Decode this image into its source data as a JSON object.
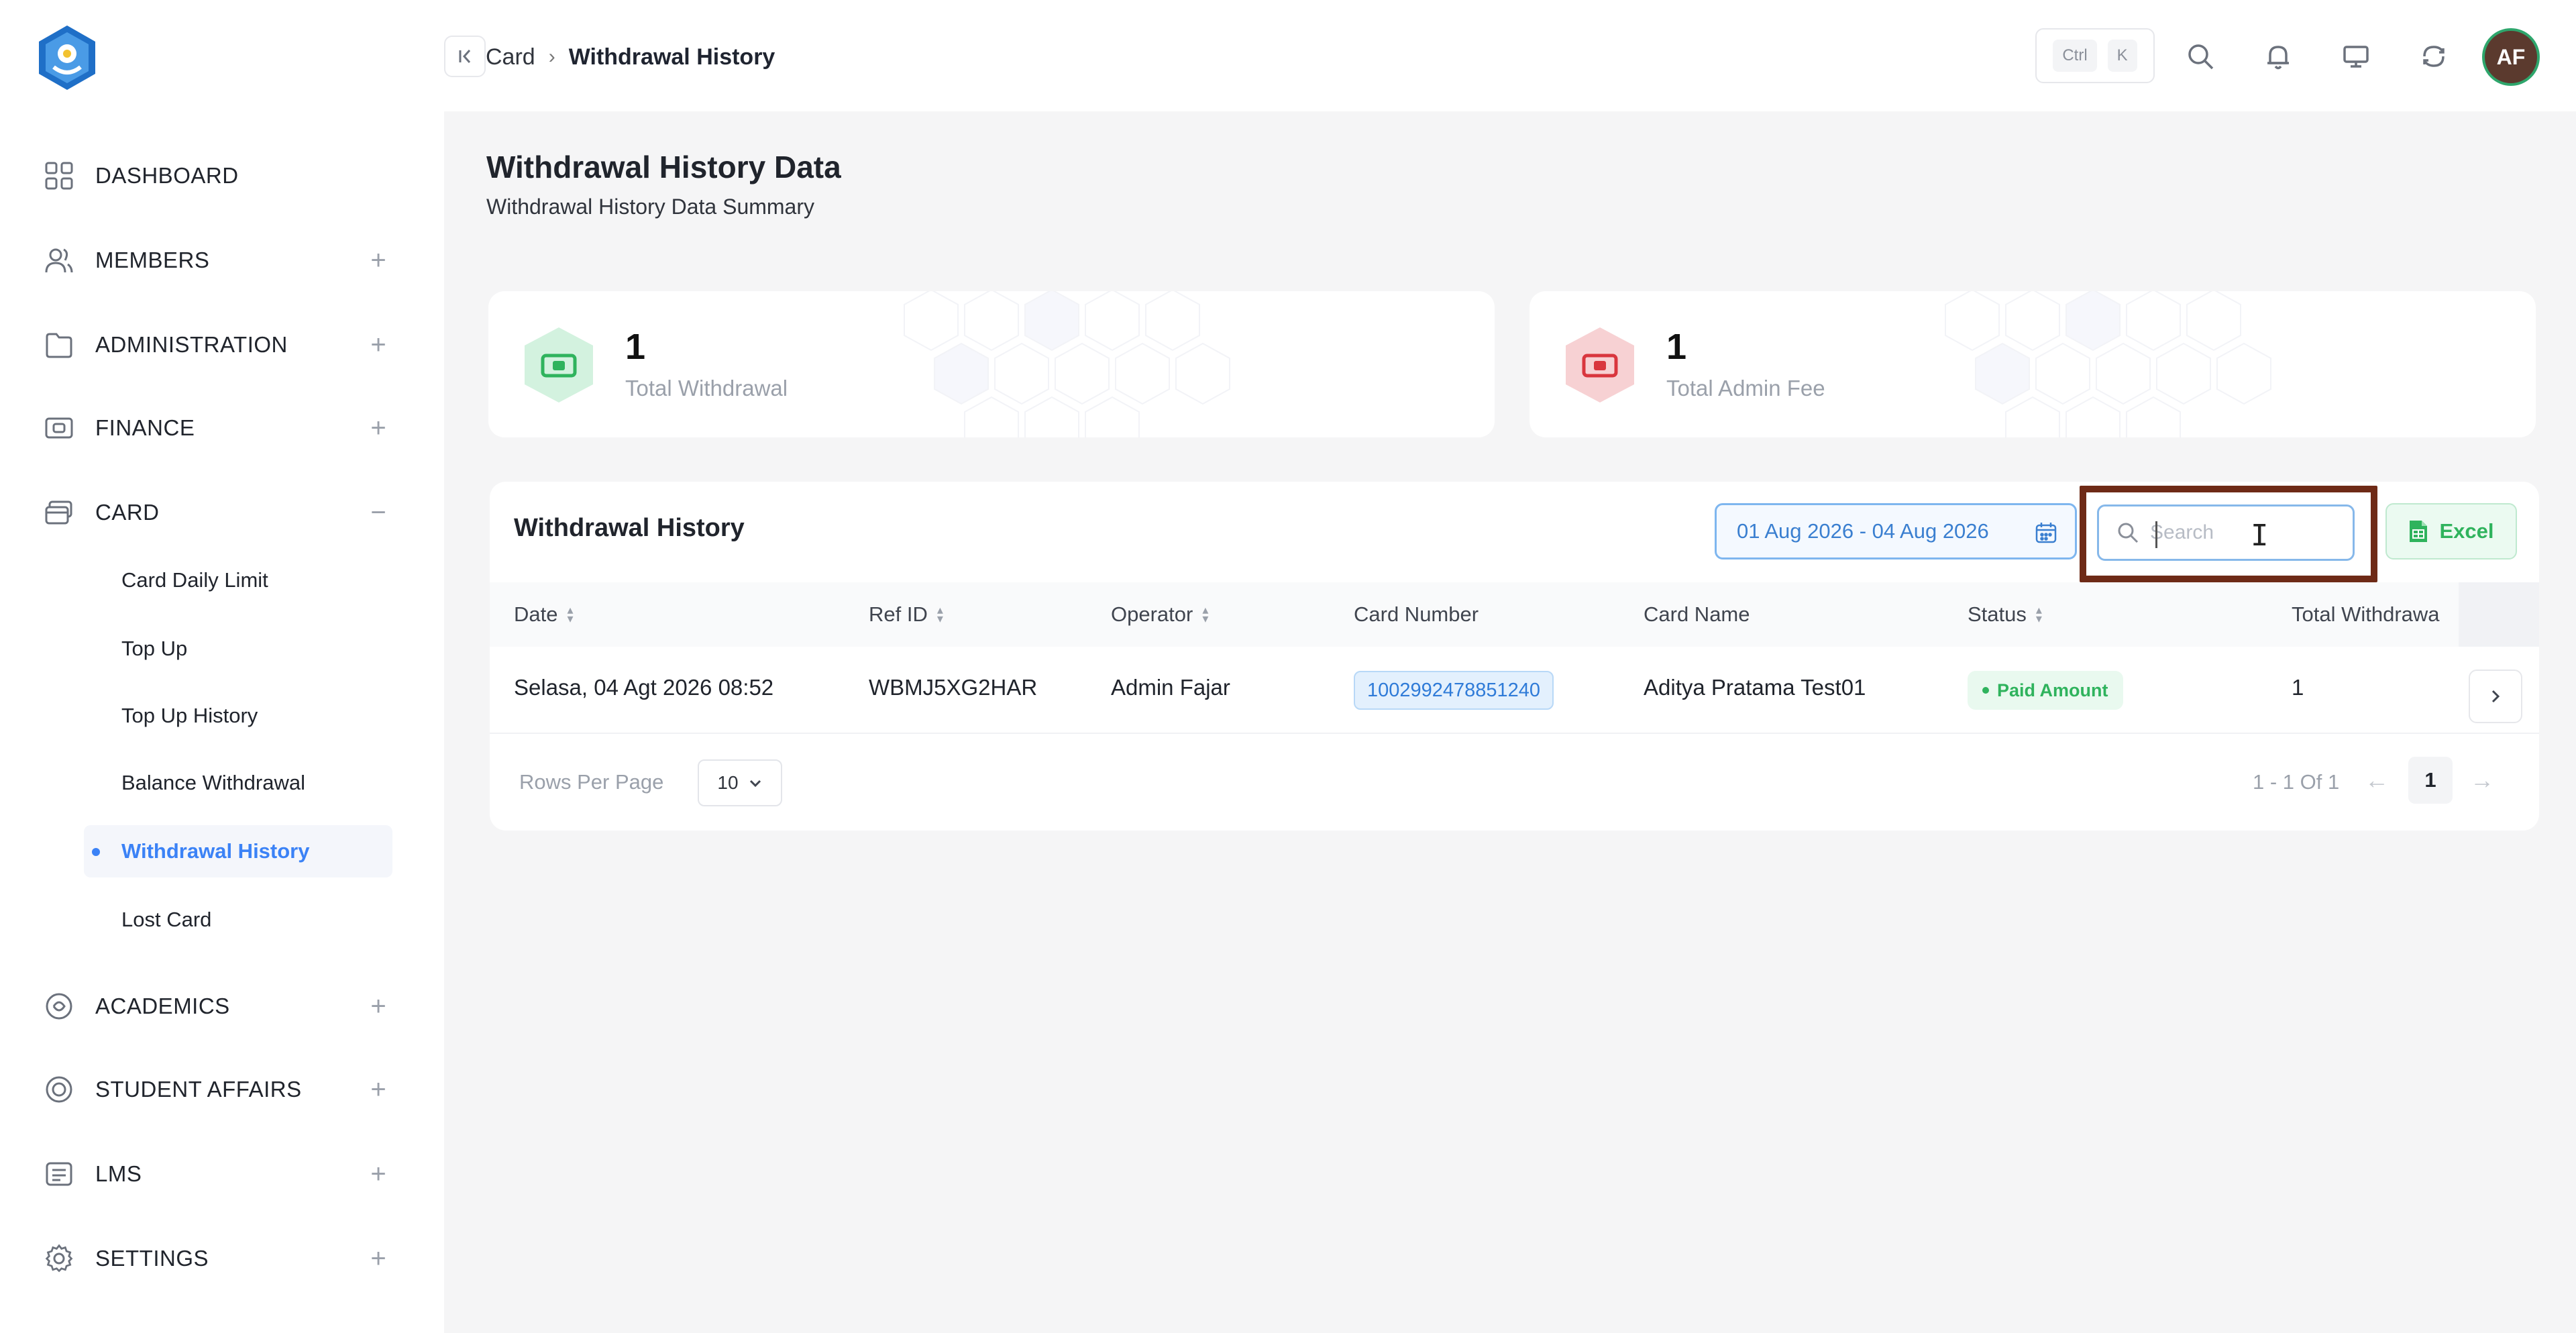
{
  "app": {
    "logo_icon": "school-emblem-icon"
  },
  "header": {
    "collapse_icon": "collapse-left-icon",
    "breadcrumb": [
      "Card",
      "Withdrawal History"
    ],
    "breadcrumb_separator": "›",
    "shortcut_keys": [
      "Ctrl",
      "K"
    ],
    "icons": [
      "search-icon",
      "bell-icon",
      "monitor-icon",
      "refresh-icon"
    ],
    "avatar_initials": "AF"
  },
  "sidebar": {
    "items": [
      {
        "label": "DASHBOARD",
        "icon": "grid-icon",
        "toggle": ""
      },
      {
        "label": "MEMBERS",
        "icon": "users-icon",
        "toggle": "+"
      },
      {
        "label": "ADMINISTRATION",
        "icon": "folder-icon",
        "toggle": "+"
      },
      {
        "label": "FINANCE",
        "icon": "money-icon",
        "toggle": "+"
      },
      {
        "label": "CARD",
        "icon": "card-icon",
        "toggle": "−"
      },
      {
        "label": "ACADEMICS",
        "icon": "academics-icon",
        "toggle": "+"
      },
      {
        "label": "STUDENT AFFAIRS",
        "icon": "student-icon",
        "toggle": "+"
      },
      {
        "label": "LMS",
        "icon": "lms-icon",
        "toggle": "+"
      },
      {
        "label": "SETTINGS",
        "icon": "gear-icon",
        "toggle": "+"
      }
    ],
    "card_subitems": [
      {
        "label": "Card Daily Limit",
        "active": false
      },
      {
        "label": "Top Up",
        "active": false
      },
      {
        "label": "Top Up History",
        "active": false
      },
      {
        "label": "Balance Withdrawal",
        "active": false
      },
      {
        "label": "Withdrawal History",
        "active": true
      },
      {
        "label": "Lost Card",
        "active": false
      }
    ]
  },
  "page": {
    "title": "Withdrawal History Data",
    "subtitle": "Withdrawal History Data Summary"
  },
  "stats": [
    {
      "value": "1",
      "label": "Total Withdrawal",
      "icon": "cash-icon",
      "color": "#2fb35d"
    },
    {
      "value": "1",
      "label": "Total Admin Fee",
      "icon": "cash-icon",
      "color": "#d9363e"
    }
  ],
  "table": {
    "title": "Withdrawal History",
    "date_range": "01 Aug 2026 - 04 Aug 2026",
    "search_placeholder": "Search",
    "search_value": "",
    "excel_label": "Excel",
    "columns": [
      "Date",
      "Ref ID",
      "Operator",
      "Card Number",
      "Card Name",
      "Status",
      "Total Withdrawa"
    ],
    "rows": [
      {
        "date": "Selasa, 04 Agt 2026 08:52",
        "ref_id": "WBMJ5XG2HAR",
        "operator": "Admin Fajar",
        "card_number": "1002992478851240",
        "card_name": "Aditya Pratama Test01",
        "status": "Paid Amount",
        "total": "1"
      }
    ],
    "rows_per_page_label": "Rows Per Page",
    "rows_per_page": "10",
    "page_info": "1 - 1 Of 1",
    "current_page": "1",
    "prev_icon": "←",
    "next_icon": "→"
  },
  "colors": {
    "accent": "#3b82f6",
    "success": "#2fb35d",
    "danger": "#d9363e",
    "highlight_border": "#6e2a16"
  }
}
